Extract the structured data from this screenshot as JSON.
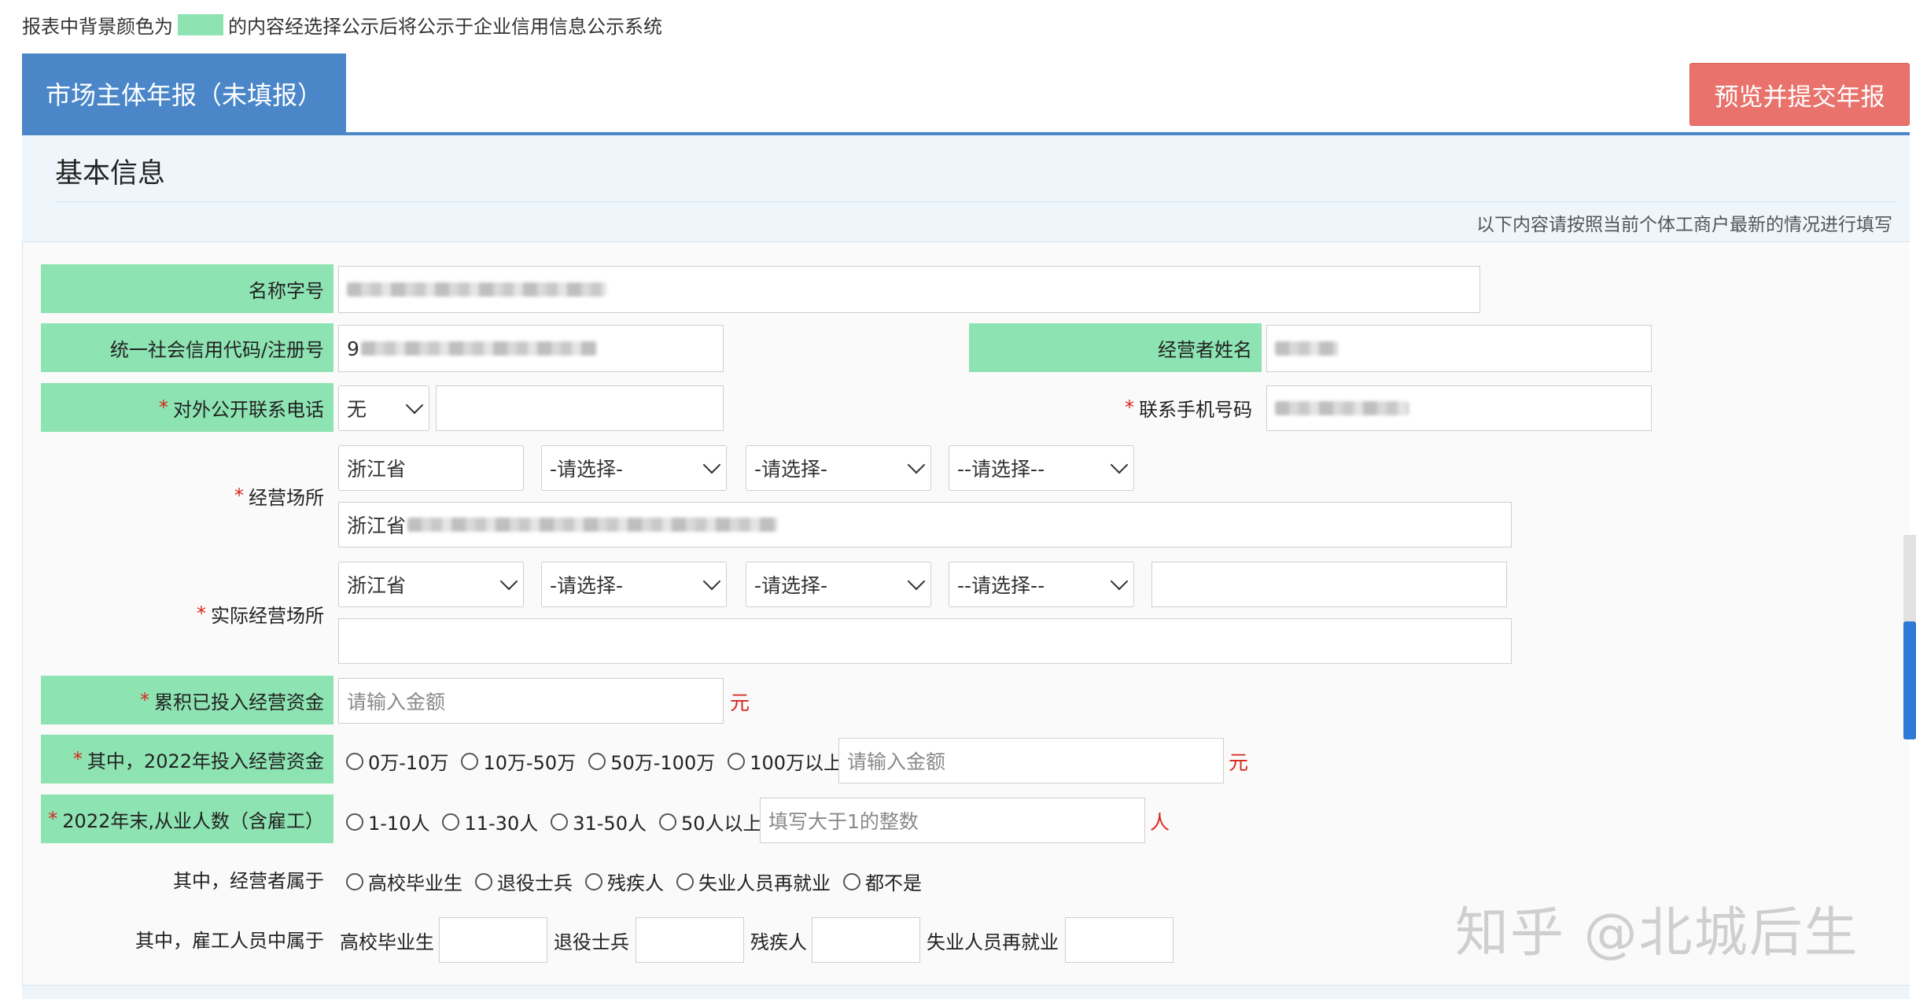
{
  "top_note": {
    "before": "报表中背景颜色为",
    "after": "的内容经选择公示后将公示于企业信用信息公示系统",
    "swatch_color": "#8de3b2"
  },
  "tab": {
    "label": "市场主体年报（未填报）"
  },
  "submit_button": {
    "label": "预览并提交年报"
  },
  "section": {
    "title": "基本信息",
    "hint": "以下内容请按照当前个体工商户最新的情况进行填写"
  },
  "form": {
    "name": {
      "label": "名称字号"
    },
    "credit_code": {
      "label": "统一社会信用代码/注册号",
      "value_prefix": "9"
    },
    "operator_name": {
      "label": "经营者姓名"
    },
    "public_phone": {
      "label": "对外公开联系电话",
      "required": "*",
      "select_value": "无"
    },
    "mobile": {
      "label": "联系手机号码",
      "required": "*"
    },
    "business_place": {
      "label": "经营场所",
      "required": "*",
      "province": "浙江省",
      "city": "-请选择-",
      "district": "-请选择-",
      "street": "--请选择--",
      "address_prefix": "浙江省"
    },
    "actual_place": {
      "label": "实际经营场所",
      "required": "*",
      "province": "浙江省",
      "city": "-请选择-",
      "district": "-请选择-",
      "street": "--请选择--"
    },
    "capital": {
      "label": "累积已投入经营资金",
      "required": "*",
      "placeholder": "请输入金额",
      "unit": "元"
    },
    "capital_2022": {
      "label": "其中，2022年投入经营资金",
      "required": "*",
      "options": [
        "0万-10万",
        "10万-50万",
        "50万-100万",
        "100万以上"
      ],
      "placeholder": "请输入金额",
      "unit": "元"
    },
    "employees": {
      "label": "2022年末,从业人数（含雇工）",
      "required": "*",
      "options": [
        "1-10人",
        "11-30人",
        "31-50人",
        "50人以上"
      ],
      "placeholder": "填写大于1的整数",
      "unit": "人"
    },
    "operator_type": {
      "label": "其中，经营者属于",
      "options": [
        "高校毕业生",
        "退役士兵",
        "残疾人",
        "失业人员再就业",
        "都不是"
      ]
    },
    "employee_type": {
      "label": "其中，雇工人员中属于",
      "fields": [
        "高校毕业生",
        "退役士兵",
        "残疾人",
        "失业人员再就业"
      ]
    }
  },
  "watermark": "知乎 @北城后生"
}
